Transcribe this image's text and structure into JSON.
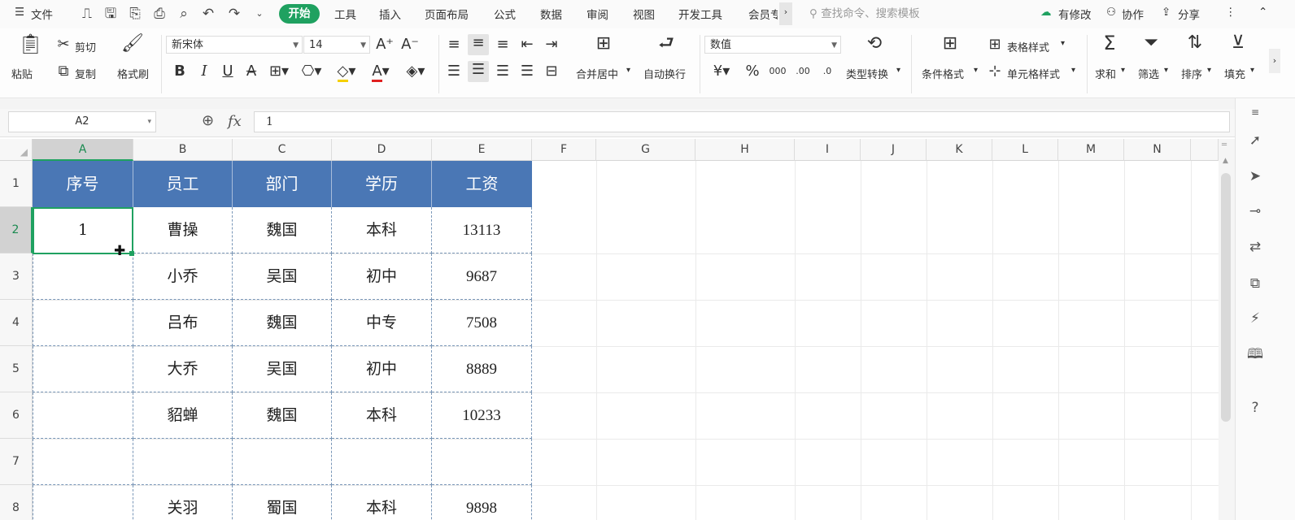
{
  "menubar": {
    "file_label": "文件",
    "tabs": [
      "开始",
      "工具",
      "插入",
      "页面布局",
      "公式",
      "数据",
      "审阅",
      "视图",
      "开发工具",
      "会员专"
    ],
    "active_tab": "开始",
    "search_placeholder": "查找命令、搜索模板",
    "status": "有修改",
    "collab": "协作",
    "share": "分享"
  },
  "ribbon": {
    "paste": "粘贴",
    "cut": "剪切",
    "copy": "复制",
    "format_painter": "格式刷",
    "font_name": "新宋体",
    "font_size": "14",
    "merge_center": "合并居中",
    "wrap_text": "自动换行",
    "number_format": "数值",
    "type_convert": "类型转换",
    "cond_format": "条件格式",
    "table_style": "表格样式",
    "cell_style": "单元格样式",
    "sum": "求和",
    "filter": "筛选",
    "sort": "排序",
    "fill": "填充"
  },
  "formula_bar": {
    "name_box": "A2",
    "fx": "fx",
    "value": "1"
  },
  "columns": [
    "A",
    "B",
    "C",
    "D",
    "E",
    "F",
    "G",
    "H",
    "I",
    "J",
    "K",
    "L",
    "M",
    "N"
  ],
  "rows": [
    "1",
    "2",
    "3",
    "4",
    "5",
    "6",
    "7",
    "8"
  ],
  "table": {
    "headers": [
      "序号",
      "员工",
      "部门",
      "学历",
      "工资"
    ],
    "rows": [
      [
        "1",
        "曹操",
        "魏国",
        "本科",
        "13113"
      ],
      [
        "",
        "小乔",
        "吴国",
        "初中",
        "9687"
      ],
      [
        "",
        "吕布",
        "魏国",
        "中专",
        "7508"
      ],
      [
        "",
        "大乔",
        "吴国",
        "初中",
        "8889"
      ],
      [
        "",
        "貂蝉",
        "魏国",
        "本科",
        "10233"
      ],
      [
        "",
        "",
        "",
        "",
        ""
      ],
      [
        "",
        "关羽",
        "蜀国",
        "本科",
        "9898"
      ]
    ]
  },
  "selected_cell": "A2",
  "colors": {
    "accent": "#1fa160",
    "header_fill": "#4a77b5"
  }
}
